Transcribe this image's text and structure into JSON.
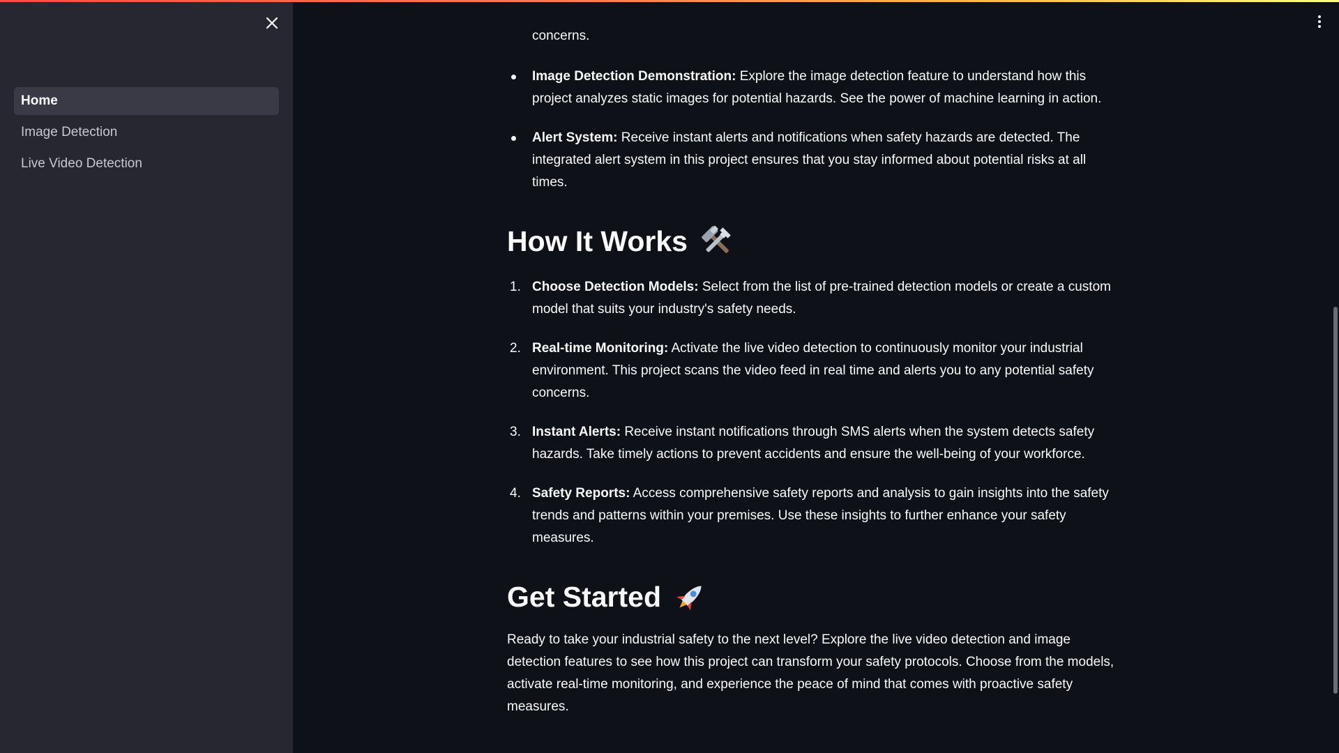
{
  "sidebar": {
    "close_icon": "close-icon",
    "items": [
      {
        "label": "Home",
        "active": true
      },
      {
        "label": "Image Detection",
        "active": false
      },
      {
        "label": "Live Video Detection",
        "active": false
      }
    ]
  },
  "header": {
    "menu_icon": "vertical-ellipsis-icon",
    "accent_gradient": [
      "#ff4b4b",
      "#ffbd45",
      "#fffd80"
    ]
  },
  "main": {
    "cut_off_text": "concerns.",
    "features": [
      {
        "title": "Image Detection Demonstration:",
        "text": " Explore the image detection feature to understand how this project analyzes static images for potential hazards. See the power of machine learning in action."
      },
      {
        "title": "Alert System:",
        "text": " Receive instant alerts and notifications when safety hazards are detected. The integrated alert system in this project ensures that you stay informed about potential risks at all times."
      }
    ],
    "how_it_works": {
      "heading": "How It Works",
      "icon": "hammer-and-wrench-icon",
      "steps": [
        {
          "number": "1.",
          "title": "Choose Detection Models:",
          "text": " Select from the list of pre-trained detection models or create a custom model that suits your industry's safety needs."
        },
        {
          "number": "2.",
          "title": "Real-time Monitoring:",
          "text": " Activate the live video detection to continuously monitor your industrial environment. This project scans the video feed in real time and alerts you to any potential safety concerns."
        },
        {
          "number": "3.",
          "title": "Instant Alerts:",
          "text": " Receive instant notifications through SMS alerts when the system detects safety hazards. Take timely actions to prevent accidents and ensure the well-being of your workforce."
        },
        {
          "number": "4.",
          "title": "Safety Reports:",
          "text": " Access comprehensive safety reports and analysis to gain insights into the safety trends and patterns within your premises. Use these insights to further enhance your safety measures."
        }
      ]
    },
    "get_started": {
      "heading": "Get Started",
      "icon": "rocket-icon",
      "text": "Ready to take your industrial safety to the next level? Explore the live video detection and image detection features to see how this project can transform your safety protocols. Choose from the models, activate real-time monitoring, and experience the peace of mind that comes with proactive safety measures."
    }
  },
  "colors": {
    "background": "#0e1117",
    "sidebar": "#262730",
    "active_nav": "#393a45",
    "text": "#fafafa"
  }
}
